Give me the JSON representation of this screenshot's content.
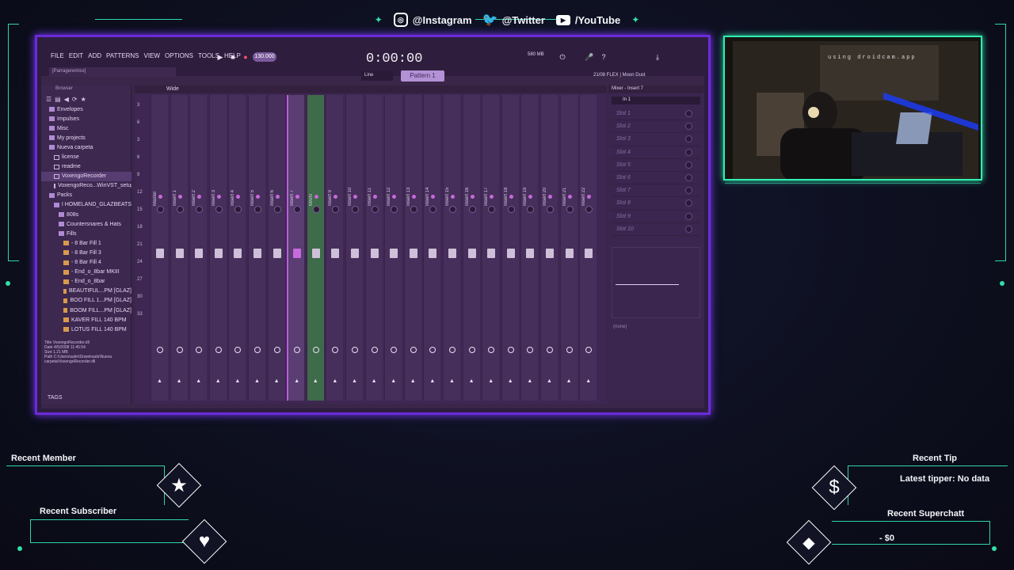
{
  "social": {
    "instagram": "@Instagram",
    "twitter": "@Twitter",
    "youtube": "/YouTube"
  },
  "fl": {
    "menus": [
      "FILE",
      "EDIT",
      "ADD",
      "PATTERNS",
      "VIEW",
      "OPTIONS",
      "TOOLS",
      "HELP"
    ],
    "hint": "[Parrageremisx]",
    "tempo": "130.000",
    "time": "0:00:00",
    "cpu": "580 MB",
    "pattern": "Pattern 1",
    "snap": "Line",
    "plugin_hint": "21/08  FLEX | Moon Dust",
    "browser_title": "Browser",
    "browser_items": [
      {
        "label": "Envelopes",
        "indent": 1,
        "type": "folder"
      },
      {
        "label": "Impulses",
        "indent": 1,
        "type": "folder"
      },
      {
        "label": "Misc",
        "indent": 1,
        "type": "folder"
      },
      {
        "label": "My projects",
        "indent": 1,
        "type": "folder"
      },
      {
        "label": "Nueva carpeta",
        "indent": 1,
        "type": "folder"
      },
      {
        "label": "license",
        "indent": 2,
        "type": "file"
      },
      {
        "label": "readme",
        "indent": 2,
        "type": "file"
      },
      {
        "label": "VoxengoRecorder",
        "indent": 2,
        "type": "file",
        "selected": true
      },
      {
        "label": "VoxengoReco...WinVST_setup",
        "indent": 2,
        "type": "file"
      },
      {
        "label": "Packs",
        "indent": 1,
        "type": "folder"
      },
      {
        "label": "I HOMELAND_GLAZBEATS",
        "indent": 2,
        "type": "folder"
      },
      {
        "label": "808s",
        "indent": 3,
        "type": "folder"
      },
      {
        "label": "Countersnares & Hats",
        "indent": 3,
        "type": "folder"
      },
      {
        "label": "Fills",
        "indent": 3,
        "type": "folder"
      },
      {
        "label": "- 8 Bar Fill 1",
        "indent": 4,
        "type": "audio"
      },
      {
        "label": "- 8 Bar Fill 3",
        "indent": 4,
        "type": "audio"
      },
      {
        "label": "- 8 Bar Fill 4",
        "indent": 4,
        "type": "audio"
      },
      {
        "label": "- End_o_8bar MKIII",
        "indent": 4,
        "type": "audio"
      },
      {
        "label": "- End_o_8bar",
        "indent": 4,
        "type": "audio"
      },
      {
        "label": "BEAUTIFUL...PM [GLAZ]",
        "indent": 4,
        "type": "audio"
      },
      {
        "label": "BOO FILL 1...PM [GLAZ]",
        "indent": 4,
        "type": "audio"
      },
      {
        "label": "BOOM FILL...PM [GLAZ]",
        "indent": 4,
        "type": "audio"
      },
      {
        "label": "KAVER FILL 140 BPM",
        "indent": 4,
        "type": "audio"
      },
      {
        "label": "LOTUS FILL 140 BPM",
        "indent": 4,
        "type": "audio"
      }
    ],
    "browser_info": [
      "Title  VoxengoRecorder.dll",
      "Date  4/5/2008 11:45:54",
      "Size  1.21 MB",
      "Path  C:\\Users\\salm\\Downloads\\Nueva carpeta\\VoxengoRecorder.dll"
    ],
    "browser_tags": "TAGS",
    "mixer_title": "Wide",
    "strips": [
      "Master",
      "Insert 1",
      "Insert 2",
      "Insert 3",
      "Insert 4",
      "Insert 5",
      "Insert 6",
      "Insert 7",
      "MAIN",
      "Insert 9",
      "Insert 10",
      "Insert 11",
      "Insert 12",
      "Insert 13",
      "Insert 14",
      "Insert 15",
      "Insert 16",
      "Insert 17",
      "Insert 18",
      "Insert 19",
      "Insert 20",
      "Insert 21",
      "Insert 22"
    ],
    "ruler": [
      "3",
      "6",
      "3",
      "6",
      "9",
      "12",
      "15",
      "18",
      "21",
      "24",
      "27",
      "30",
      "33"
    ],
    "insert_title": "Mixer - Insert 7",
    "insert_input": "In 1",
    "slots": [
      "Slot 1",
      "Slot 2",
      "Slot 3",
      "Slot 4",
      "Slot 5",
      "Slot 6",
      "Slot 7",
      "Slot 8",
      "Slot 9",
      "Slot 10"
    ],
    "insert_footer": "(none)"
  },
  "cam": {
    "text": "using droidcam.app"
  },
  "widgets": {
    "recent_member": "Recent Member",
    "recent_subscriber": "Recent Subscriber",
    "recent_tip": "Recent Tip",
    "latest_tipper": "Latest tipper: No data",
    "recent_superchat": "Recent Superchatt",
    "superchat_value": "- $0"
  },
  "colors": {
    "accent": "#2fd6a8",
    "frame": "#6b2bd8"
  }
}
